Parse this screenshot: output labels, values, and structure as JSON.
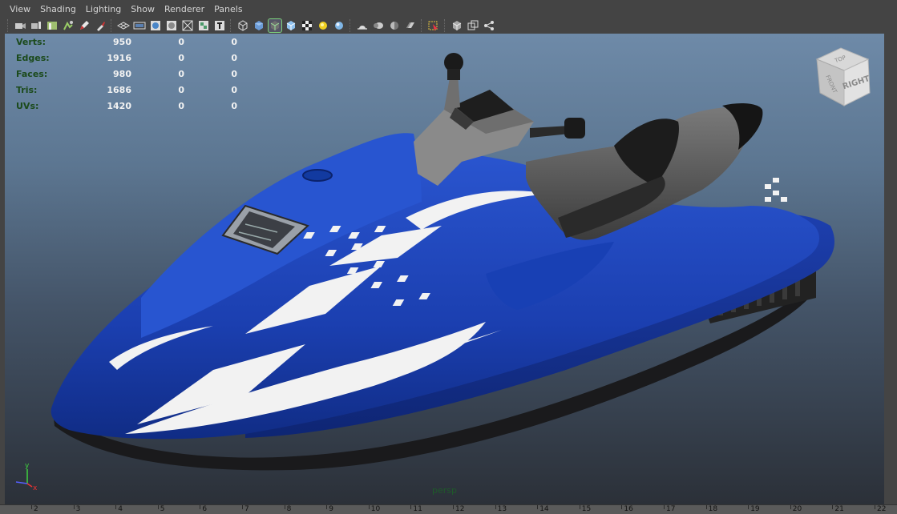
{
  "menu": [
    "View",
    "Shading",
    "Lighting",
    "Show",
    "Renderer",
    "Panels"
  ],
  "toolbar_icons": [
    "camera-attributes-icon",
    "camera-bookmark-icon",
    "image-plane-icon",
    "2d-pan-zoom-icon",
    "grease-pencil-icon",
    "paint-brush-icon",
    "sep",
    "grid-icon",
    "film-gate-icon",
    "resolution-gate-icon",
    "gate-mask-icon",
    "field-chart-icon",
    "safe-action-icon",
    "safe-title-icon",
    "sep",
    "wireframe-icon",
    "smooth-shade-icon",
    "wireframe-on-shaded-icon",
    "default-material-icon",
    "textured-icon",
    "use-all-lights-icon",
    "shadows-icon",
    "sep",
    "screen-space-ao-icon",
    "motion-blur-icon",
    "multisample-aa-icon",
    "depth-of-field-icon",
    "sep",
    "isolate-select-icon",
    "sep",
    "xray-icon",
    "xray-joints-icon",
    "xray-active-components-icon"
  ],
  "active_toolbar_icon": "wireframe-on-shaded-icon",
  "hud": {
    "rows": [
      {
        "label": "Verts:",
        "v1": "950",
        "v2": "0",
        "v3": "0"
      },
      {
        "label": "Edges:",
        "v1": "1916",
        "v2": "0",
        "v3": "0"
      },
      {
        "label": "Faces:",
        "v1": "980",
        "v2": "0",
        "v3": "0"
      },
      {
        "label": "Tris:",
        "v1": "1686",
        "v2": "0",
        "v3": "0"
      },
      {
        "label": "UVs:",
        "v1": "1420",
        "v2": "0",
        "v3": "0"
      }
    ]
  },
  "viewcube": {
    "top": "TOP",
    "front": "FRONT",
    "right": "RIGHT"
  },
  "axis": {
    "x": "x",
    "y": "y"
  },
  "camera_label": "persp",
  "timeline_ticks": [
    "2",
    "3",
    "4",
    "5",
    "6",
    "7",
    "8",
    "9",
    "10",
    "11",
    "12",
    "13",
    "14",
    "15",
    "16",
    "17",
    "18",
    "19",
    "20",
    "21",
    "22"
  ],
  "colors": {
    "hull_blue": "#1b3fb0",
    "hud_label_green": "#1b4a1b",
    "camera_label_green": "#1f5a2a",
    "active_highlight": "#7cd17c"
  }
}
